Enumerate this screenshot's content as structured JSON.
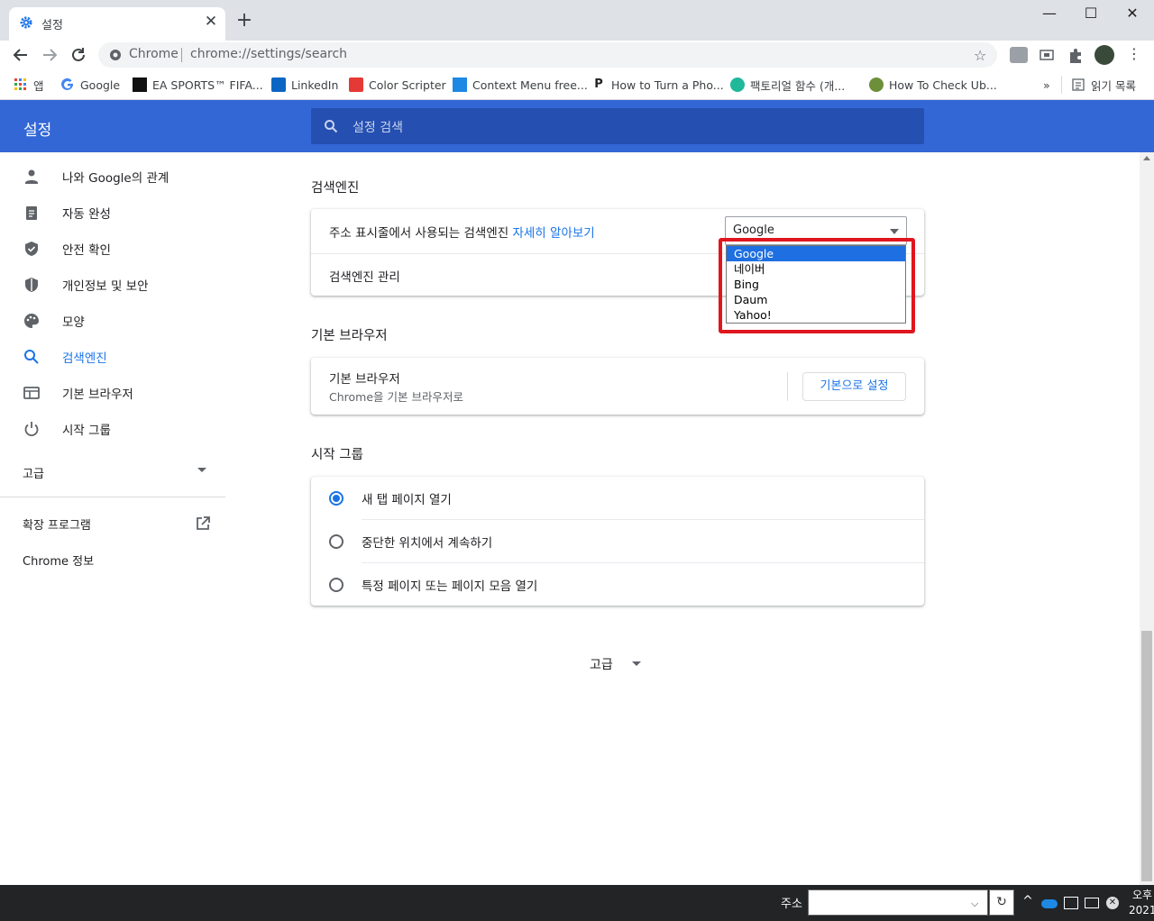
{
  "browser": {
    "tab_title": "설정",
    "omnibox_site": "Chrome",
    "omnibox_url": "chrome://settings/search"
  },
  "bookmarks": [
    {
      "label": "앱",
      "icon": "apps-grid-icon"
    },
    {
      "label": "Google",
      "icon": "google-icon"
    },
    {
      "label": "EA SPORTS™ FIFA...",
      "icon": "ea-sports-icon"
    },
    {
      "label": "LinkedIn",
      "icon": "linkedin-icon"
    },
    {
      "label": "Color Scripter",
      "icon": "color-scripter-icon"
    },
    {
      "label": "Context Menu free...",
      "icon": "context-menu-icon"
    },
    {
      "label": "How to Turn a Pho...",
      "icon": "p-letter-icon"
    },
    {
      "label": "팩토리얼 함수 (개...",
      "icon": "factorial-icon"
    },
    {
      "label": "How To Check Ub...",
      "icon": "gear-site-icon"
    }
  ],
  "bookmarks_more": "»",
  "reading_list": "읽기 목록",
  "settings": {
    "title": "설정",
    "search_placeholder": "설정 검색"
  },
  "sidebar": {
    "items": [
      {
        "label": "나와 Google의 관계",
        "icon": "person-icon"
      },
      {
        "label": "자동 완성",
        "icon": "clipboard-icon"
      },
      {
        "label": "안전 확인",
        "icon": "shield-check-icon"
      },
      {
        "label": "개인정보 및 보안",
        "icon": "security-shield-icon"
      },
      {
        "label": "모양",
        "icon": "palette-icon"
      },
      {
        "label": "검색엔진",
        "icon": "search-icon"
      },
      {
        "label": "기본 브라우저",
        "icon": "browser-window-icon"
      },
      {
        "label": "시작 그룹",
        "icon": "power-icon"
      }
    ],
    "selected_index": 5,
    "advanced": "고급",
    "extensions": "확장 프로그램",
    "about": "Chrome 정보"
  },
  "search_engine": {
    "heading": "검색엔진",
    "row1_text": "주소 표시줄에서 사용되는 검색엔진 ",
    "row1_link": "자세히 알아보기",
    "selected": "Google",
    "options": [
      "Google",
      "네이버",
      "Bing",
      "Daum",
      "Yahoo!"
    ],
    "row2_text": "검색엔진 관리"
  },
  "default_browser": {
    "heading": "기본 브라우저",
    "title": "기본 브라우저",
    "subtitle": "Chrome을 기본 브라우저로",
    "button": "기본으로 설정"
  },
  "on_startup": {
    "heading": "시작 그룹",
    "options": [
      "새 탭 페이지 열기",
      "중단한 위치에서 계속하기",
      "특정 페이지 또는 페이지 모음 열기"
    ],
    "selected_index": 0
  },
  "advanced_bottom": "고급",
  "taskbar": {
    "address_label": "주소",
    "clock_line1": "오후",
    "clock_line2": "2021"
  },
  "colors": {
    "header_blue": "#3367d6",
    "accent": "#1a73e8",
    "highlight_red": "#e0161e"
  }
}
